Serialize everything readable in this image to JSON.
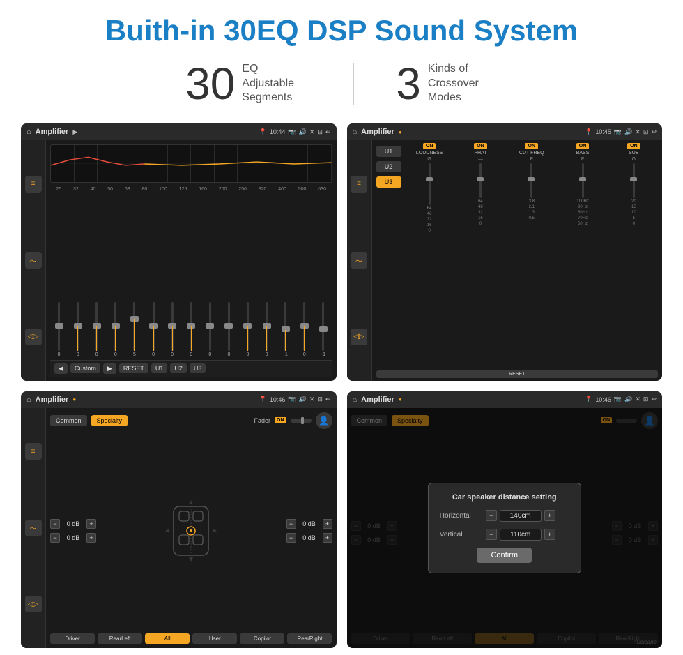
{
  "page": {
    "title": "Buith-in 30EQ DSP Sound System",
    "stats": [
      {
        "number": "30",
        "label": "EQ Adjustable\nSegments"
      },
      {
        "number": "3",
        "label": "Kinds of\nCrossover Modes"
      }
    ]
  },
  "screens": {
    "eq": {
      "title": "Amplifier",
      "time": "10:44",
      "freq_labels": [
        "25",
        "32",
        "40",
        "50",
        "63",
        "80",
        "100",
        "125",
        "160",
        "200",
        "250",
        "320",
        "400",
        "500",
        "630"
      ],
      "values": [
        "0",
        "0",
        "0",
        "0",
        "5",
        "0",
        "0",
        "0",
        "0",
        "0",
        "0",
        "0",
        "-1",
        "0",
        "-1"
      ],
      "bottom": {
        "custom_label": "Custom",
        "reset_label": "RESET",
        "u1_label": "U1",
        "u2_label": "U2",
        "u3_label": "U3"
      }
    },
    "crossover": {
      "title": "Amplifier",
      "time": "10:45",
      "u_buttons": [
        "U1",
        "U2",
        "U3"
      ],
      "active_u": "U3",
      "channels": [
        {
          "name": "LOUDNESS",
          "on": true
        },
        {
          "name": "PHAT",
          "on": true
        },
        {
          "name": "CUT FREQ",
          "on": true
        },
        {
          "name": "BASS",
          "on": true
        },
        {
          "name": "SUB",
          "on": true
        }
      ],
      "reset_label": "RESET"
    },
    "speaker": {
      "title": "Amplifier",
      "time": "10:46",
      "common_label": "Common",
      "specialty_label": "Specialty",
      "fader_label": "Fader",
      "fader_on": "ON",
      "controls": {
        "front_left_db": "0 dB",
        "front_right_db": "0 dB",
        "rear_left_db": "0 dB",
        "rear_right_db": "0 dB"
      },
      "buttons": [
        "Driver",
        "RearLeft",
        "All",
        "User",
        "Copilot",
        "RearRight"
      ],
      "active_btn": "All"
    },
    "dialog": {
      "title": "Amplifier",
      "time": "10:46",
      "dialog": {
        "title": "Car speaker distance setting",
        "horizontal_label": "Horizontal",
        "horizontal_value": "140cm",
        "vertical_label": "Vertical",
        "vertical_value": "110cm",
        "confirm_label": "Confirm"
      },
      "buttons": [
        "Driver",
        "RearLeft",
        "Copilot",
        "RearRight"
      ],
      "common_label": "Common",
      "specialty_label": "Specialty"
    }
  },
  "watermark": "Seicane"
}
